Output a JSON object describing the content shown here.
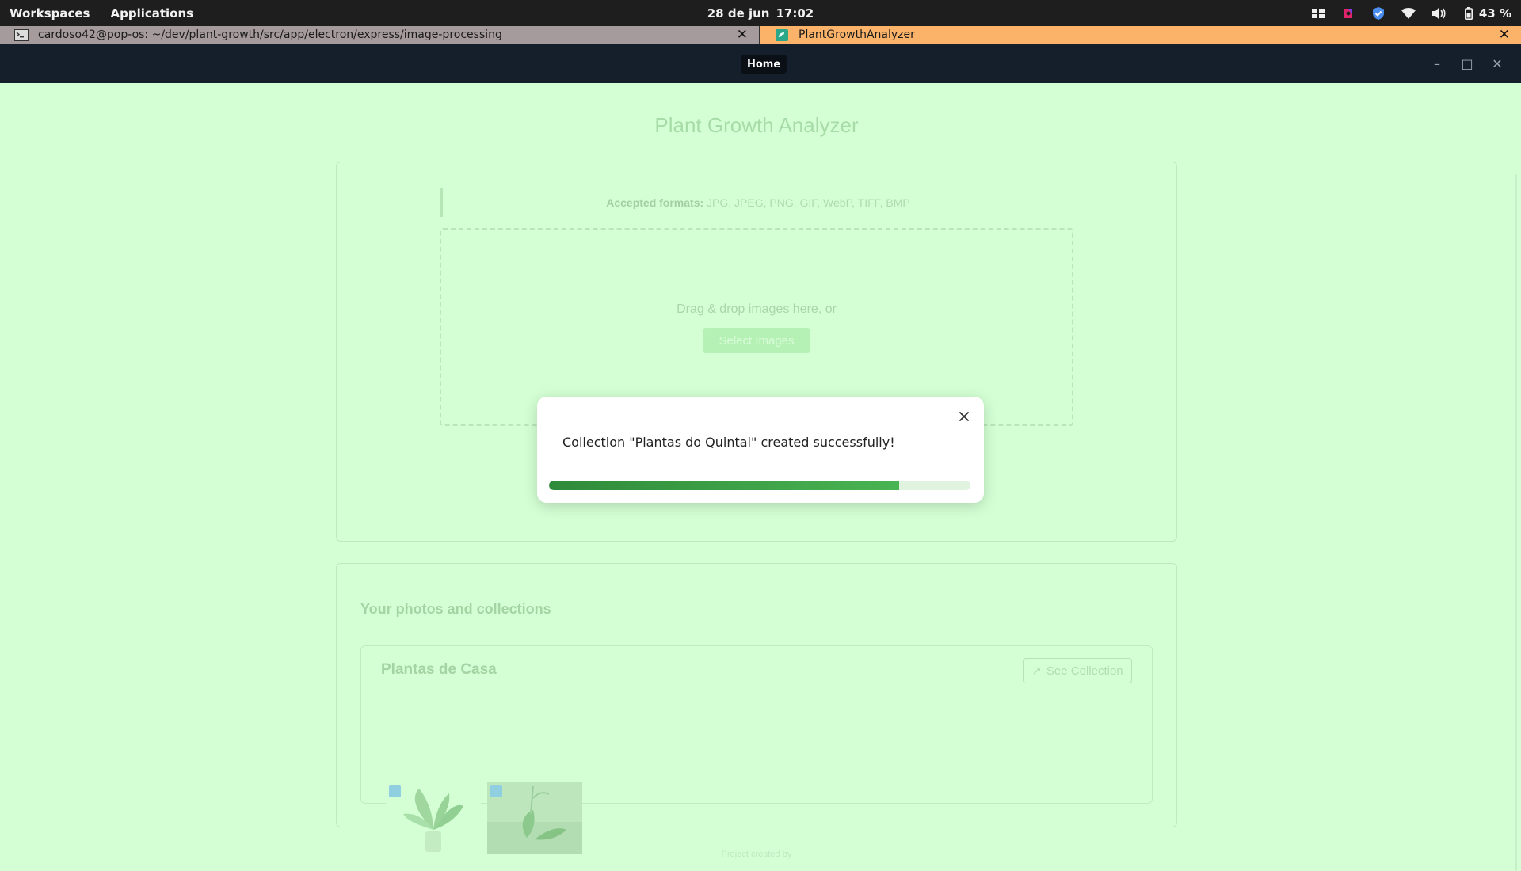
{
  "system_bar": {
    "workspaces": "Workspaces",
    "applications": "Applications",
    "date": "28 de jun",
    "time": "17:02",
    "battery": "43 %",
    "tray_icons": [
      "layout-icon",
      "app-indicator-icon",
      "shield-icon",
      "wifi-icon",
      "volume-icon",
      "battery-icon"
    ]
  },
  "window_tabs": [
    {
      "title": "cardoso42@pop-os: ~/dev/plant-growth/src/app/electron/express/image-processing",
      "icon": "terminal-icon",
      "close": "✕"
    },
    {
      "title": "PlantGrowthAnalyzer",
      "icon": "app-icon",
      "close": "✕"
    }
  ],
  "header": {
    "nav_home": "Home",
    "minimize": "–",
    "maximize": "□",
    "close": "✕"
  },
  "page": {
    "title": "Plant Growth Analyzer",
    "formats_label": "Accepted formats:",
    "formats_value": "JPG, JPEG, PNG, GIF, WebP, TIFF, BMP",
    "drop_text": "Drag & drop images here, or",
    "select_button": "Select Images"
  },
  "collections": {
    "section_title": "Your photos and collections",
    "items": [
      {
        "name": "Plantas de Casa",
        "see_button": "See Collection",
        "photos": 2
      }
    ]
  },
  "footer": {
    "text": "Project created by"
  },
  "toast": {
    "message": "Collection \"Plantas do Quintal\" created successfully!",
    "progress": 0.83,
    "colors": {
      "fill": "#3a9a45",
      "track": "#dff3df"
    }
  },
  "colors": {
    "background": "#d4ffd4",
    "header": "#151e2b",
    "system_bar": "#1e1e1e",
    "active_tab": "#fbb36a",
    "terminal_tab": "#a59a9c"
  }
}
